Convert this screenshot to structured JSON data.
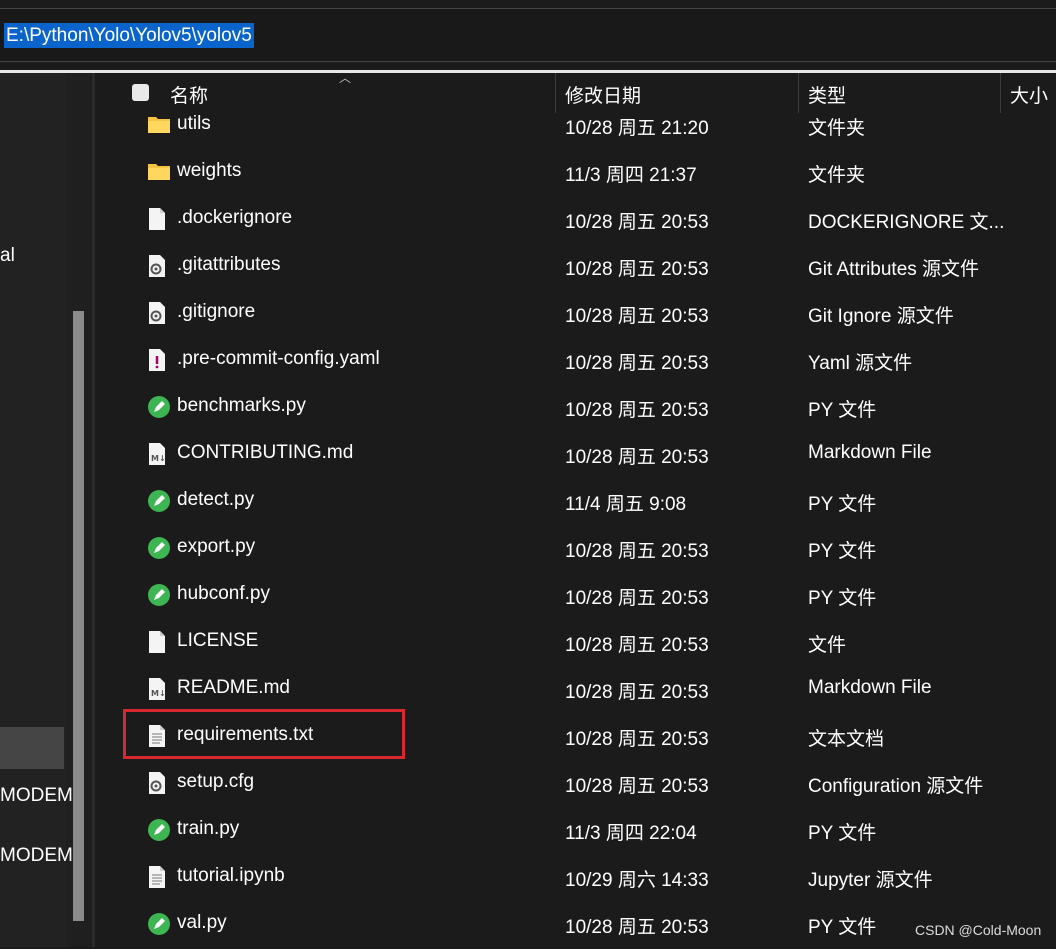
{
  "address": {
    "path": "E:\\Python\\Yolo\\Yolov5\\yolov5"
  },
  "nav": {
    "items": [
      "al",
      "MODEM",
      "MODEM"
    ]
  },
  "columns": {
    "name": "名称",
    "date": "修改日期",
    "type": "类型",
    "size": "大小"
  },
  "rows": [
    {
      "name": "utils",
      "date": "10/28 周五 21:20",
      "type": "文件夹",
      "icon": "folder-icon"
    },
    {
      "name": "weights",
      "date": "11/3 周四 21:37",
      "type": "文件夹",
      "icon": "folder-icon"
    },
    {
      "name": ".dockerignore",
      "date": "10/28 周五 20:53",
      "type": "DOCKERIGNORE 文...",
      "icon": "file-icon"
    },
    {
      "name": ".gitattributes",
      "date": "10/28 周五 20:53",
      "type": "Git Attributes 源文件",
      "icon": "config-file-icon"
    },
    {
      "name": ".gitignore",
      "date": "10/28 周五 20:53",
      "type": "Git Ignore 源文件",
      "icon": "config-file-icon"
    },
    {
      "name": ".pre-commit-config.yaml",
      "date": "10/28 周五 20:53",
      "type": "Yaml 源文件",
      "icon": "yaml-file-icon"
    },
    {
      "name": "benchmarks.py",
      "date": "10/28 周五 20:53",
      "type": "PY 文件",
      "icon": "python-file-icon"
    },
    {
      "name": "CONTRIBUTING.md",
      "date": "10/28 周五 20:53",
      "type": "Markdown File",
      "icon": "markdown-file-icon"
    },
    {
      "name": "detect.py",
      "date": "11/4 周五 9:08",
      "type": "PY 文件",
      "icon": "python-file-icon"
    },
    {
      "name": "export.py",
      "date": "10/28 周五 20:53",
      "type": "PY 文件",
      "icon": "python-file-icon"
    },
    {
      "name": "hubconf.py",
      "date": "10/28 周五 20:53",
      "type": "PY 文件",
      "icon": "python-file-icon"
    },
    {
      "name": "LICENSE",
      "date": "10/28 周五 20:53",
      "type": "文件",
      "icon": "file-icon"
    },
    {
      "name": "README.md",
      "date": "10/28 周五 20:53",
      "type": "Markdown File",
      "icon": "markdown-file-icon"
    },
    {
      "name": "requirements.txt",
      "date": "10/28 周五 20:53",
      "type": "文本文档",
      "icon": "text-file-icon"
    },
    {
      "name": "setup.cfg",
      "date": "10/28 周五 20:53",
      "type": "Configuration 源文件",
      "icon": "config-file-icon"
    },
    {
      "name": "train.py",
      "date": "11/3 周四 22:04",
      "type": "PY 文件",
      "icon": "python-file-icon"
    },
    {
      "name": "tutorial.ipynb",
      "date": "10/29 周六 14:33",
      "type": "Jupyter 源文件",
      "icon": "text-file-icon"
    },
    {
      "name": "val.py",
      "date": "10/28 周五 20:53",
      "type": "PY 文件",
      "icon": "python-file-icon"
    }
  ],
  "highlight_color": "#d7282f",
  "watermark": "CSDN @Cold-Moon"
}
